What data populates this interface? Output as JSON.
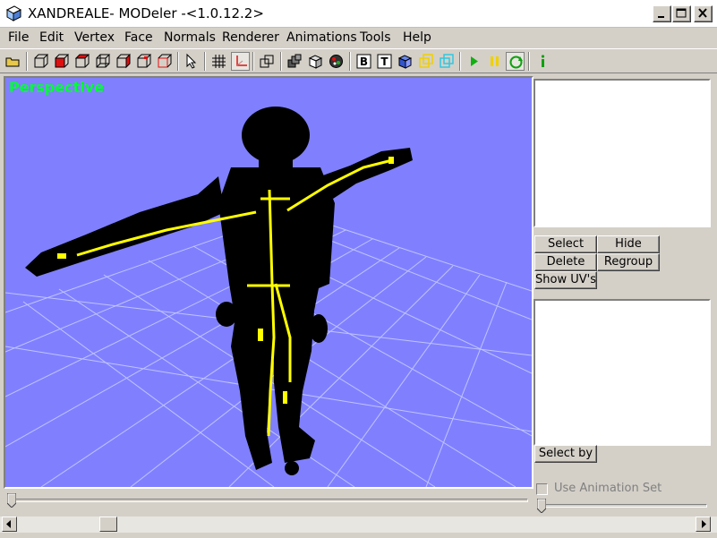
{
  "window": {
    "title": "XANDREALE- MODeler -<1.0.12.2>",
    "icon": "cube-wireframe-icon"
  },
  "menu": [
    {
      "label": "File"
    },
    {
      "label": "Edit"
    },
    {
      "label": "Vertex"
    },
    {
      "label": "Face"
    },
    {
      "label": "Normals"
    },
    {
      "label": "Renderer"
    },
    {
      "label": "Animations"
    },
    {
      "label": "Tools"
    },
    {
      "label": "Help"
    }
  ],
  "toolbar": {
    "icons": [
      "open-folder-icon",
      "box-wire-icon",
      "box-red-face-icon",
      "box-red-edge-icon",
      "box-outline-icon",
      "box-red-top-icon",
      "box-red-side-icon",
      "box-red-corner-icon",
      "arrow-select-icon",
      "grid-icon",
      "axis-icon",
      "box-duplicate-icon",
      "stacked-boxes-icon",
      "solid-box-icon",
      "globe-icon",
      "bold-b-icon",
      "text-t-icon",
      "texture-cube-icon",
      "yellow-square-icon",
      "cyan-square-icon",
      "play-icon",
      "pause-icon",
      "loop-icon",
      "info-icon"
    ]
  },
  "viewport": {
    "label": "Perspective",
    "background": "#8080ff",
    "label_color": "#00ff33",
    "grid_color": "#bfc4ff",
    "mesh_color": "#000000",
    "bone_color": "#ffff00"
  },
  "panel": {
    "select_label": "Select",
    "hide_label": "Hide",
    "delete_label": "Delete",
    "regroup_label": "Regroup",
    "show_uvs_label": "Show UV's",
    "select_by_label": "Select by",
    "use_animation_set_label": "Use Animation Set",
    "use_animation_set_checked": false
  },
  "timeline": {
    "position": 0.0
  },
  "scrollbar": {
    "position": 0.14
  }
}
